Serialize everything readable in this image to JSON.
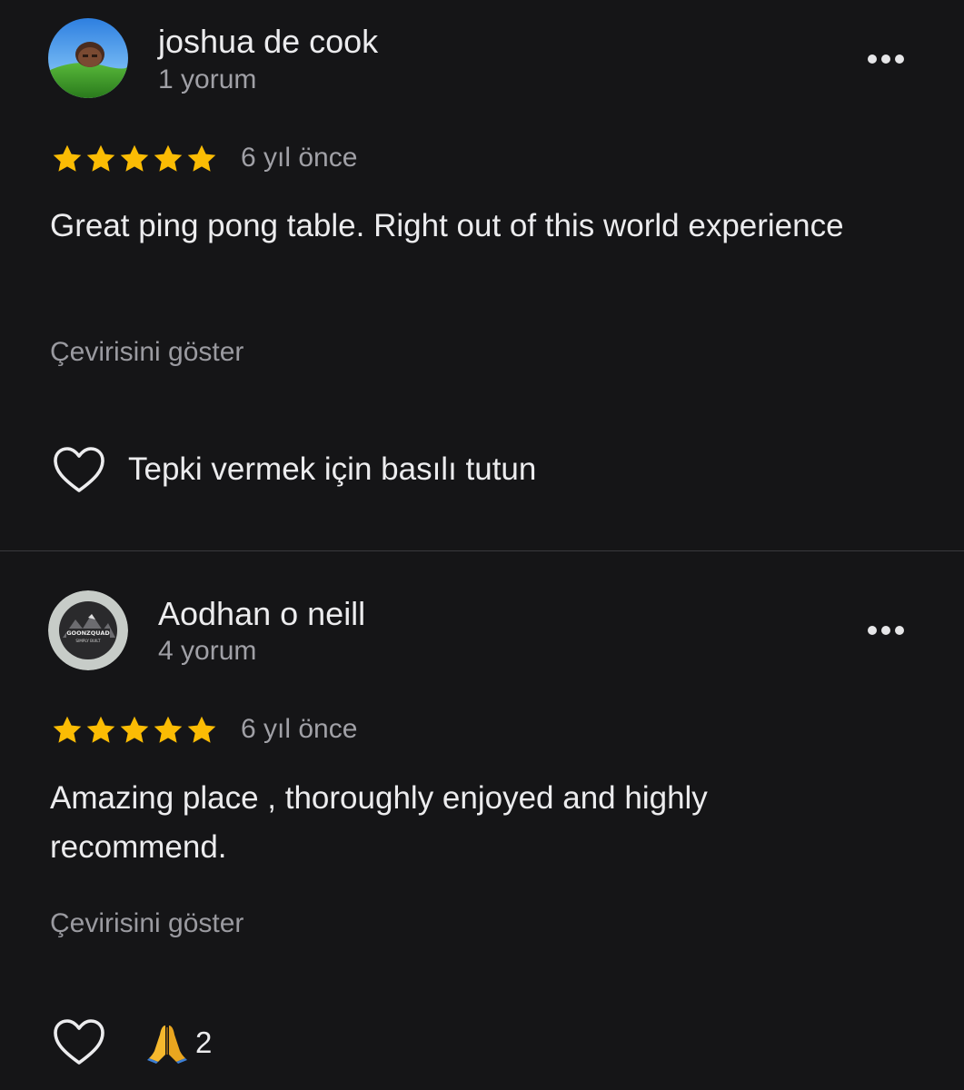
{
  "reviews": [
    {
      "author": "joshua de cook",
      "review_count": "1 yorum",
      "rating": 5,
      "date": "6 yıl önce",
      "text": "Great ping pong table. Right out of this world experience",
      "translate_label": "Çevirisini göster",
      "react_hint": "Tepki vermek için basılı tutun",
      "reactions": null
    },
    {
      "author": "Aodhan o neill",
      "review_count": "4 yorum",
      "rating": 5,
      "date": "6 yıl önce",
      "text": "Amazing place , thoroughly enjoyed and highly recommend.",
      "translate_label": "Çevirisini göster",
      "react_hint": null,
      "avatar_logo_text": [
        "GOONZQUAD",
        "SIMPLY BUILT"
      ],
      "reactions": {
        "emoji": "folded-hands",
        "count": "2"
      }
    }
  ],
  "colors": {
    "background": "#151517",
    "star": "#fbbc04",
    "primary_text": "#ececee",
    "secondary_text": "#a0a0a6",
    "divider": "#3a3a3e"
  },
  "icons": [
    "more-options-icon",
    "star-icon",
    "heart-outline-icon",
    "folded-hands-emoji"
  ]
}
